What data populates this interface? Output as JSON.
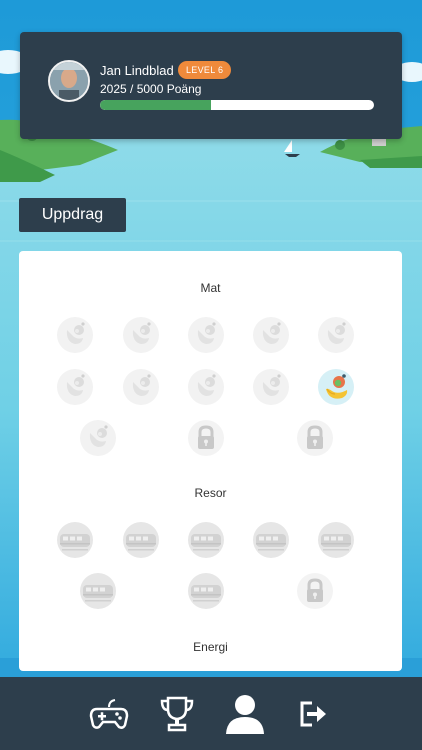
{
  "profile": {
    "name": "Jan Lindblad",
    "level_badge": "LEVEL 6",
    "points_text": "2025 / 5000 Poäng",
    "progress_fraction": 0.405
  },
  "section": {
    "title": "Uppdrag"
  },
  "categories": [
    {
      "key": "mat",
      "title": "Mat",
      "badges": [
        {
          "state": "locked-grey",
          "icon": "food-icon"
        },
        {
          "state": "locked-grey",
          "icon": "food-icon"
        },
        {
          "state": "locked-grey",
          "icon": "food-icon"
        },
        {
          "state": "locked-grey",
          "icon": "food-icon"
        },
        {
          "state": "locked-grey",
          "icon": "food-icon"
        },
        {
          "state": "locked-grey",
          "icon": "food-icon"
        },
        {
          "state": "locked-grey",
          "icon": "food-icon"
        },
        {
          "state": "locked-grey",
          "icon": "food-icon"
        },
        {
          "state": "locked-grey",
          "icon": "food-icon"
        },
        {
          "state": "unlocked",
          "icon": "food-icon"
        },
        {
          "state": "locked-grey",
          "icon": "food-icon"
        },
        {
          "state": "padlock",
          "icon": "padlock-icon"
        },
        {
          "state": "padlock",
          "icon": "padlock-icon"
        }
      ]
    },
    {
      "key": "resor",
      "title": "Resor",
      "badges": [
        {
          "state": "locked-grey",
          "icon": "train-icon"
        },
        {
          "state": "locked-grey",
          "icon": "train-icon"
        },
        {
          "state": "locked-grey",
          "icon": "train-icon"
        },
        {
          "state": "locked-grey",
          "icon": "train-icon"
        },
        {
          "state": "locked-grey",
          "icon": "train-icon"
        },
        {
          "state": "locked-grey",
          "icon": "train-icon"
        },
        {
          "state": "locked-grey",
          "icon": "train-icon"
        },
        {
          "state": "padlock",
          "icon": "padlock-icon"
        }
      ]
    },
    {
      "key": "energi",
      "title": "Energi",
      "badges": []
    }
  ],
  "nav": [
    {
      "key": "games",
      "icon": "gamepad-icon"
    },
    {
      "key": "trophies",
      "icon": "trophy-icon"
    },
    {
      "key": "profile",
      "icon": "user-icon"
    },
    {
      "key": "logout",
      "icon": "logout-icon"
    }
  ],
  "colors": {
    "card": "#2d3e4c",
    "accent_orange": "#ef8a3b",
    "progress_green": "#47a35d",
    "sky": "#29a3dc",
    "water": "#6fd0e6"
  }
}
